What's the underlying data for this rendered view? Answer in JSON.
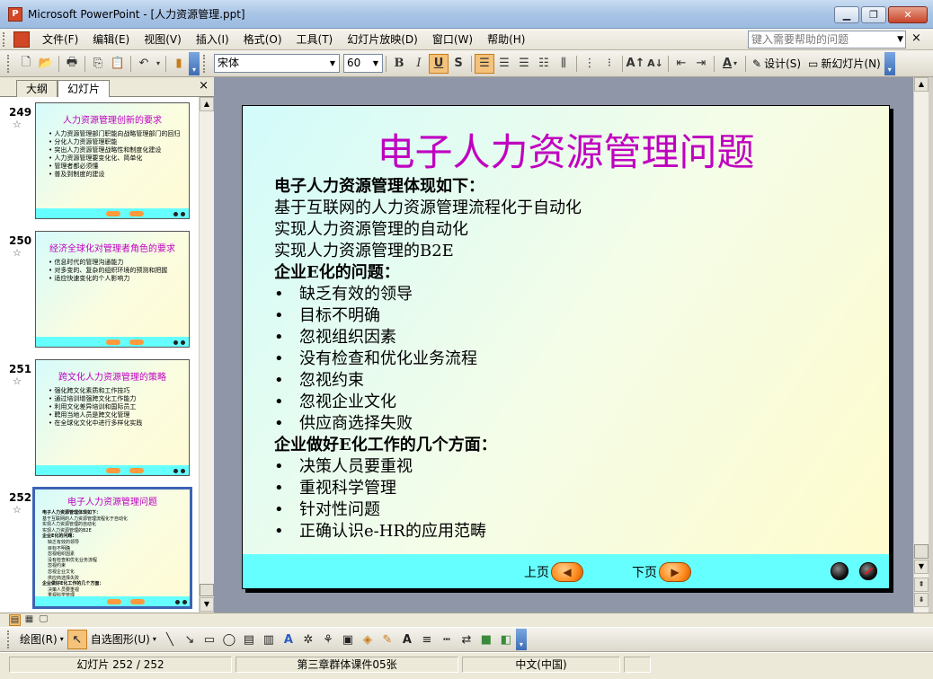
{
  "window": {
    "title": "Microsoft PowerPoint - [人力资源管理.ppt]",
    "app_icon_letter": "P",
    "min_label": "▁",
    "restore_label": "❐",
    "close_label": "✕"
  },
  "menu": {
    "items": [
      "文件(F)",
      "编辑(E)",
      "视图(V)",
      "插入(I)",
      "格式(O)",
      "工具(T)",
      "幻灯片放映(D)",
      "窗口(W)",
      "帮助(H)"
    ],
    "help_placeholder": "键入需要帮助的问题",
    "close_label": "×"
  },
  "toolbar": {
    "font_name": "宋体",
    "font_size": "60",
    "bold_label": "B",
    "italic_label": "I",
    "underline_label": "U",
    "shadow_label": "S",
    "design_label": "设计(S)",
    "new_slide_label": "新幻灯片(N)",
    "font_color_label": "A"
  },
  "left_pane": {
    "tab_outline": "大纲",
    "tab_slides": "幻灯片",
    "close_label": "×",
    "slides": [
      {
        "number": "249",
        "title": "人力资源管理创新的要求",
        "lines": [
          "人力资源管理部门职能向战略管理部门的回归",
          "分化人力资源管理职能",
          "突出人力资源管理战略性和制度化建设",
          "人力资源管理要变化化、简单化",
          "管理者都必须懂",
          "普及到制度的建设"
        ]
      },
      {
        "number": "250",
        "title": "经济全球化对管理者角色的要求",
        "lines": [
          "信息时代的管理沟通能力",
          "对多变的、复杂的组织环境的预测和把握",
          "适应快速变化的个人影响力"
        ]
      },
      {
        "number": "251",
        "title": "跨文化人力资源管理的策略",
        "lines": [
          "强化跨文化素质和工作技巧",
          "通过培训增强跨文化工作能力",
          "利用文化差异培训和国际员工",
          "聘用当地人员是跨文化管理",
          "在全球化文化中进行多样化实践"
        ]
      },
      {
        "number": "252",
        "title": "电子人力资源管理问题"
      }
    ]
  },
  "slide": {
    "title": "电子人力资源管理问题",
    "lines": [
      {
        "text": "电子人力资源管理体现如下：",
        "style": "bold"
      },
      {
        "text": "基于互联网的人力资源管理流程化于自动化",
        "style": "plain"
      },
      {
        "text": "实现人力资源管理的自动化",
        "style": "plain"
      },
      {
        "text": "实现人力资源管理的B2E",
        "style": "plain"
      },
      {
        "text": "企业E化的问题：",
        "style": "bold"
      },
      {
        "text": "缺乏有效的领导",
        "style": "bullet"
      },
      {
        "text": "目标不明确",
        "style": "bullet"
      },
      {
        "text": "忽视组织因素",
        "style": "bullet"
      },
      {
        "text": "没有检查和优化业务流程",
        "style": "bullet"
      },
      {
        "text": "忽视约束",
        "style": "bullet"
      },
      {
        "text": "忽视企业文化",
        "style": "bullet"
      },
      {
        "text": "供应商选择失败",
        "style": "bullet"
      },
      {
        "text": "企业做好E化工作的几个方面：",
        "style": "bold"
      },
      {
        "text": "决策人员要重视",
        "style": "bullet"
      },
      {
        "text": "重视科学管理",
        "style": "bullet"
      },
      {
        "text": "针对性问题",
        "style": "bullet"
      },
      {
        "text": "正确认识e-HR的应用范畴",
        "style": "bullet"
      }
    ],
    "prev_label": "上页",
    "next_label": "下页"
  },
  "drawbar": {
    "draw_label": "绘图(R)",
    "autoshapes_label": "自选图形(U)"
  },
  "status": {
    "slide_info": "幻灯片 252 / 252",
    "design_name": "第三章群体课件05张",
    "language": "中文(中国)"
  },
  "colors": {
    "title_magenta": "#c000c0",
    "footer_cyan": "#66ffff",
    "nav_orange": "#ff8a1e"
  }
}
